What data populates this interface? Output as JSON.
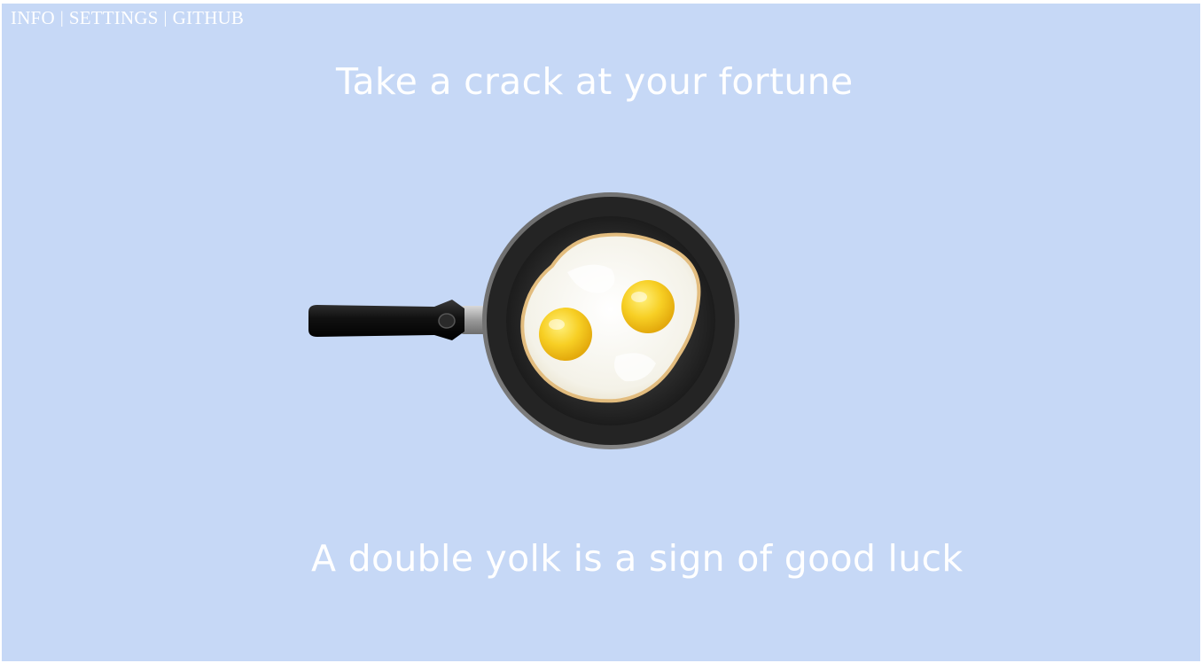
{
  "nav": {
    "info": "INFO",
    "settings": "SETTINGS",
    "github": "GITHUB",
    "separator": "|"
  },
  "headline": "Take a crack at your fortune",
  "fortune": "A double yolk is a sign of good luck",
  "pan_icon": "frying-pan-with-double-yolk-egg",
  "colors": {
    "background": "#c6d8f6",
    "text": "#ffffff",
    "pan": "#2e2e2e",
    "yolk": "#f5c518",
    "egg_white": "#f8f6ef"
  }
}
